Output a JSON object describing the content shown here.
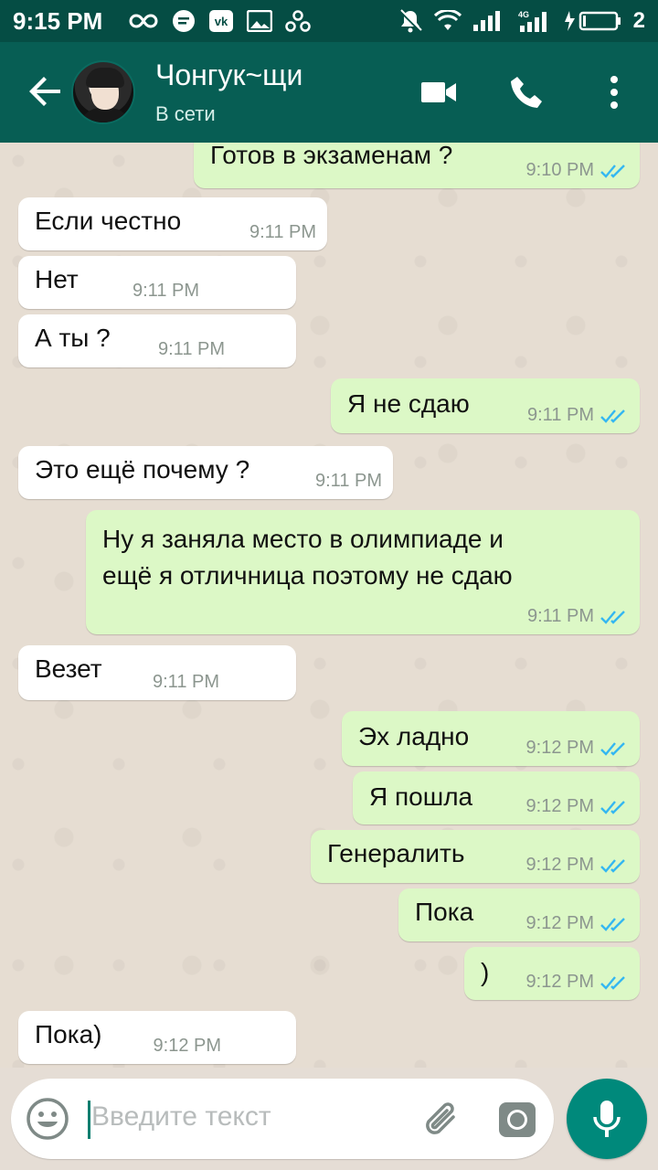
{
  "status_bar": {
    "time": "9:15 PM",
    "battery_level": "2",
    "network": "4G"
  },
  "header": {
    "contact_name": "Чонгук~щи",
    "contact_status": "В сети"
  },
  "messages": [
    {
      "dir": "out",
      "text": "Готов в экзаменам ?",
      "time": "9:10 PM",
      "read": true
    },
    {
      "dir": "in",
      "text": "Если честно",
      "time": "9:11 PM"
    },
    {
      "dir": "in",
      "text": "Нет",
      "time": "9:11 PM"
    },
    {
      "dir": "in",
      "text": "А ты ?",
      "time": "9:11 PM"
    },
    {
      "dir": "out",
      "text": "Я не сдаю",
      "time": "9:11 PM",
      "read": true
    },
    {
      "dir": "in",
      "text": "Это ещё почему ?",
      "time": "9:11 PM"
    },
    {
      "dir": "out",
      "text_line1": "Ну я заняла место в олимпиаде и",
      "text_line2": "ещё я отличница поэтому не сдаю",
      "time": "9:11 PM",
      "read": true
    },
    {
      "dir": "in",
      "text": "Везет",
      "time": "9:11 PM"
    },
    {
      "dir": "out",
      "text": "Эх ладно",
      "time": "9:12 PM",
      "read": true
    },
    {
      "dir": "out",
      "text": "Я пошла",
      "time": "9:12 PM",
      "read": true
    },
    {
      "dir": "out",
      "text": "Генералить",
      "time": "9:12 PM",
      "read": true
    },
    {
      "dir": "out",
      "text": "Пока",
      "time": "9:12 PM",
      "read": true
    },
    {
      "dir": "out",
      "text": ")",
      "time": "9:12 PM",
      "read": true
    },
    {
      "dir": "in",
      "text": "Пока)",
      "time": "9:12 PM"
    }
  ],
  "input": {
    "placeholder": "Введите текст"
  },
  "colors": {
    "header": "#075e54",
    "status_bar": "#054d44",
    "incoming_bubble": "#ffffff",
    "outgoing_bubble": "#dcf8c6",
    "read_ticks": "#34b7f1",
    "mic_button": "#00897b"
  },
  "icons": [
    "back-arrow-icon",
    "video-call-icon",
    "phone-icon",
    "more-vert-icon",
    "emoji-icon",
    "attach-icon",
    "camera-icon",
    "mic-icon",
    "double-check-icon"
  ]
}
